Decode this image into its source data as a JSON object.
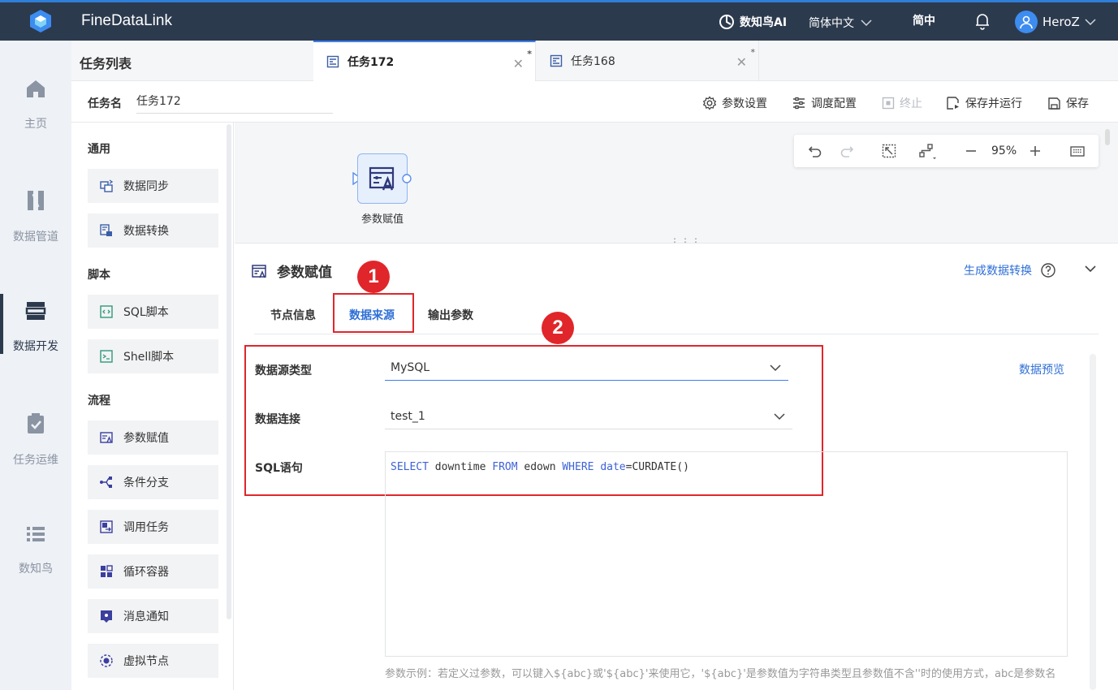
{
  "app": {
    "brand": "FineDataLink",
    "ai": "数知鸟AI",
    "language": "简体中文",
    "locale_short": "简中",
    "user": "HeroZ"
  },
  "nav": [
    {
      "label": "主页",
      "icon": "home-icon"
    },
    {
      "label": "数据管道",
      "icon": "pipeline-icon"
    },
    {
      "label": "数据开发",
      "icon": "develop-icon",
      "active": true
    },
    {
      "label": "任务运维",
      "icon": "clipboard-icon"
    },
    {
      "label": "数知鸟",
      "icon": "list-icon"
    }
  ],
  "list_title": "任务列表",
  "tabs": [
    {
      "label": "任务172",
      "active": true,
      "modified": "*"
    },
    {
      "label": "任务168",
      "active": false,
      "modified": "*"
    }
  ],
  "task": {
    "name_label": "任务名",
    "name_value": "任务172"
  },
  "actions": {
    "params": "参数设置",
    "schedule": "调度配置",
    "stop": "终止",
    "save_run": "保存并运行",
    "save": "保存"
  },
  "palette": {
    "sections": [
      {
        "title": "通用",
        "items": [
          "数据同步",
          "数据转换"
        ]
      },
      {
        "title": "脚本",
        "items": [
          "SQL脚本",
          "Shell脚本"
        ]
      },
      {
        "title": "流程",
        "items": [
          "参数赋值",
          "条件分支",
          "调用任务",
          "循环容器",
          "消息通知",
          "虚拟节点"
        ]
      }
    ]
  },
  "canvas": {
    "zoom": "95%",
    "node_label": "参数赋值"
  },
  "panel": {
    "title": "参数赋值",
    "generate": "生成数据转换",
    "tabs": [
      "节点信息",
      "数据来源",
      "输出参数"
    ],
    "active_tab": "数据来源",
    "badges": [
      "1",
      "2"
    ],
    "fields": {
      "source_type_label": "数据源类型",
      "source_type_value": "MySQL",
      "connection_label": "数据连接",
      "connection_value": "test_1",
      "sql_label": "SQL语句",
      "sql": {
        "select": "SELECT",
        "col": " downtime ",
        "from": "FROM",
        "table": " edown ",
        "where": "WHERE",
        "cond_l": " date",
        "cond_r": "=CURDATE()"
      }
    },
    "preview": "数据预览",
    "hint": "参数示例：若定义过参数，可以键入${abc}或'${abc}'来使用它，'${abc}'是参数值为字符串类型且参数值不含''时的使用方式，abc是参数名"
  },
  "colors": {
    "topbar": "#2c3a4e",
    "accent": "#2f6fd6",
    "highlight": "#e0262b"
  }
}
